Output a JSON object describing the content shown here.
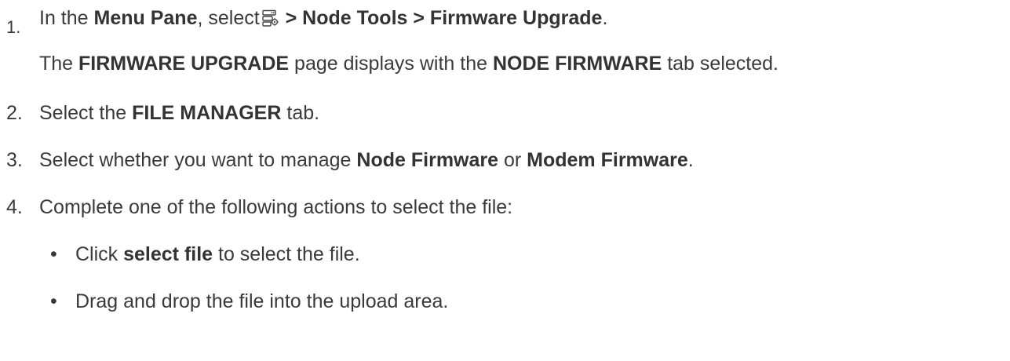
{
  "steps": [
    {
      "number": "1.",
      "parts": {
        "p1": "In the ",
        "b1": "Menu Pane",
        "p2": ", select",
        "icon": "node-tools-menu-icon",
        "b2": " > Node Tools > Firmware Upgrade",
        "p3": "."
      },
      "followup": {
        "p1": "The ",
        "b1": "FIRMWARE UPGRADE",
        "p2": " page displays with the ",
        "b2": "NODE FIRMWARE",
        "p3": " tab selected."
      }
    },
    {
      "number": "2.",
      "parts": {
        "p1": "Select the ",
        "b1": "FILE MANAGER",
        "p2": " tab."
      }
    },
    {
      "number": "3.",
      "parts": {
        "p1": "Select whether you want to manage ",
        "b1": "Node Firmware",
        "p2": " or ",
        "b2": "Modem Firmware",
        "p3": "."
      }
    },
    {
      "number": "4.",
      "parts": {
        "p1": "Complete one of the following actions to select the file:"
      },
      "bullets": [
        {
          "marker": "•",
          "p1": "Click ",
          "b1": "select file",
          "p2": " to select the file."
        },
        {
          "marker": "•",
          "p1": "Drag and drop the file into the upload area."
        }
      ]
    }
  ]
}
